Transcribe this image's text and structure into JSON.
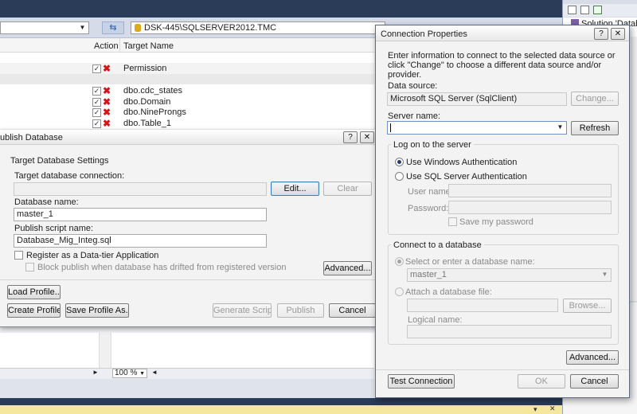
{
  "bg": {
    "server": "DSK-445\\SQLSERVER2012.TMC",
    "col_action": "Action",
    "col_target": "Target Name",
    "rows": [
      {
        "name": "Permission"
      },
      {
        "name": "dbo.cdc_states"
      },
      {
        "name": "dbo.Domain"
      },
      {
        "name": "dbo.NineProngs"
      },
      {
        "name": "dbo.Table_1"
      }
    ],
    "zoom": "100 %",
    "right_panel": {
      "solution_text": "Solution 'Database"
    }
  },
  "publish": {
    "title": "ublish Database",
    "help_label": "?",
    "close_label": "✕",
    "section": "Target Database Settings",
    "target_conn_label": "Target database connection:",
    "target_conn_value": "",
    "edit_btn": "Edit...",
    "clear_btn": "Clear",
    "dbname_label": "Database name:",
    "dbname_value": "master_1",
    "script_label": "Publish script name:",
    "script_value": "Database_Mig_Integ.sql",
    "register_label": "Register as a Data-tier Application",
    "block_label": "Block publish when database has drifted from registered version",
    "advanced_btn": "Advanced...",
    "load_profile_btn": "Load Profile...",
    "create_profile_btn": "Create Profile",
    "save_profile_btn": "Save Profile As...",
    "generate_btn": "Generate Script",
    "publish_btn": "Publish",
    "cancel_btn": "Cancel"
  },
  "conn": {
    "title": "Connection Properties",
    "help_label": "?",
    "close_label": "✕",
    "intro": "Enter information to connect to the selected data source or click \"Change\" to choose a different data source and/or provider.",
    "ds_label": "Data source:",
    "ds_value": "Microsoft SQL Server (SqlClient)",
    "change_btn": "Change...",
    "server_label": "Server name:",
    "server_value": "",
    "refresh_btn": "Refresh",
    "logon_group": "Log on to the server",
    "win_auth": "Use Windows Authentication",
    "sql_auth": "Use SQL Server Authentication",
    "user_label": "User name:",
    "pass_label": "Password:",
    "save_pw": "Save my password",
    "connect_group": "Connect to a database",
    "select_db": "Select or enter a database name:",
    "db_value": "master_1",
    "attach_file": "Attach a database file:",
    "browse_btn": "Browse...",
    "logical_label": "Logical name:",
    "advanced_btn": "Advanced...",
    "test_btn": "Test Connection",
    "ok_btn": "OK",
    "cancel_btn": "Cancel"
  }
}
